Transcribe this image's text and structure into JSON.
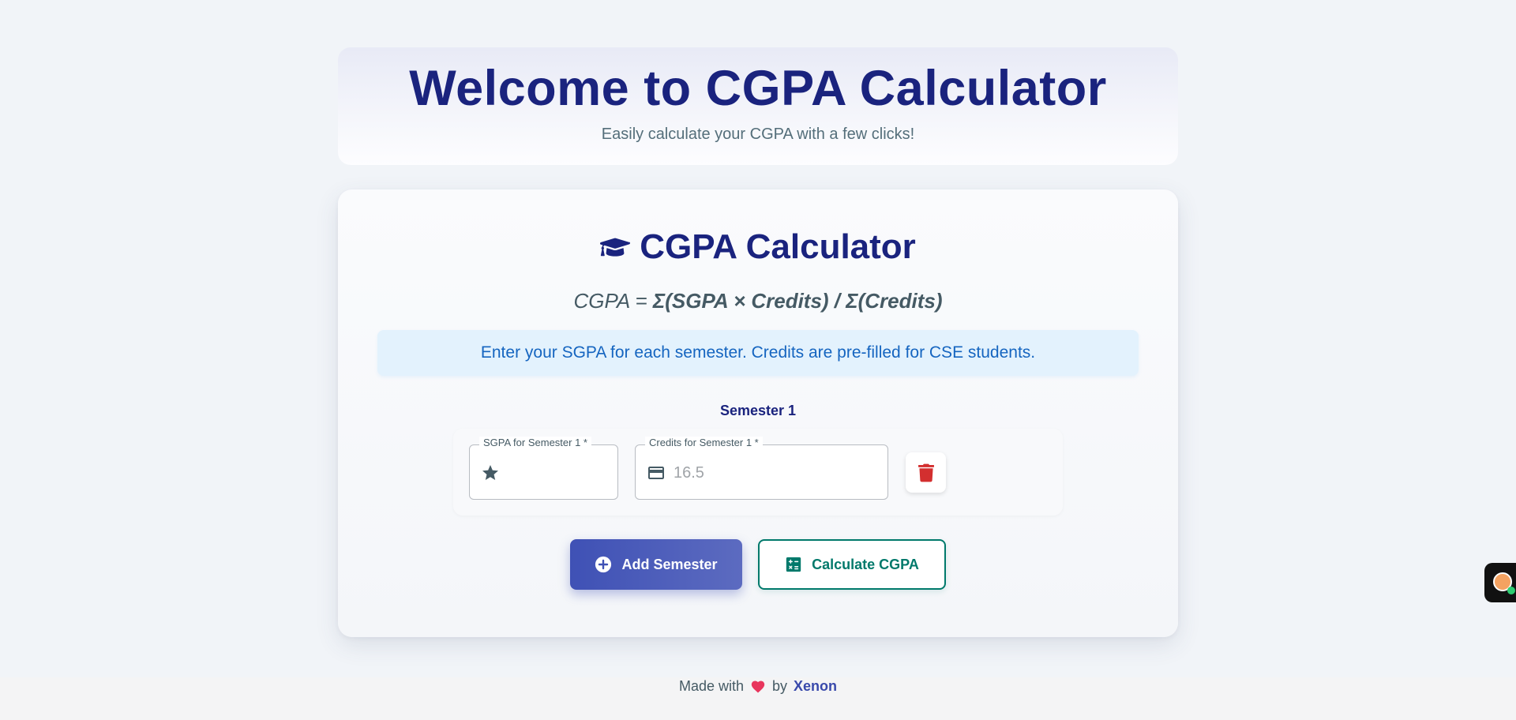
{
  "hero": {
    "title": "Welcome to CGPA Calculator",
    "subtitle": "Easily calculate your CGPA with a few clicks!"
  },
  "calculator": {
    "title": "CGPA Calculator",
    "icon": "graduation-cap-icon",
    "formula_lhs": "CGPA = ",
    "formula_rhs": "Σ(SGPA × Credits) / Σ(Credits)",
    "info": "Enter your SGPA for each semester. Credits are pre-filled for CSE students.",
    "semesters": [
      {
        "label": "Semester 1",
        "sgpa_label": "SGPA for Semester 1 *",
        "sgpa_value": "",
        "sgpa_icon": "star-icon",
        "credits_label": "Credits for Semester 1 *",
        "credits_placeholder": "16.5",
        "credits_icon": "credit-card-icon",
        "delete_icon": "trash-icon"
      }
    ],
    "add_button": "Add Semester",
    "calculate_button": "Calculate CGPA"
  },
  "footer": {
    "made_with": "Made with",
    "by": "by",
    "author": "Xenon"
  },
  "colors": {
    "primary": "#1a237e",
    "accent": "#3f51b5",
    "teal": "#00796b",
    "danger": "#d32f2f",
    "info_bg": "#e3f2fd",
    "info_text": "#1565c0"
  }
}
